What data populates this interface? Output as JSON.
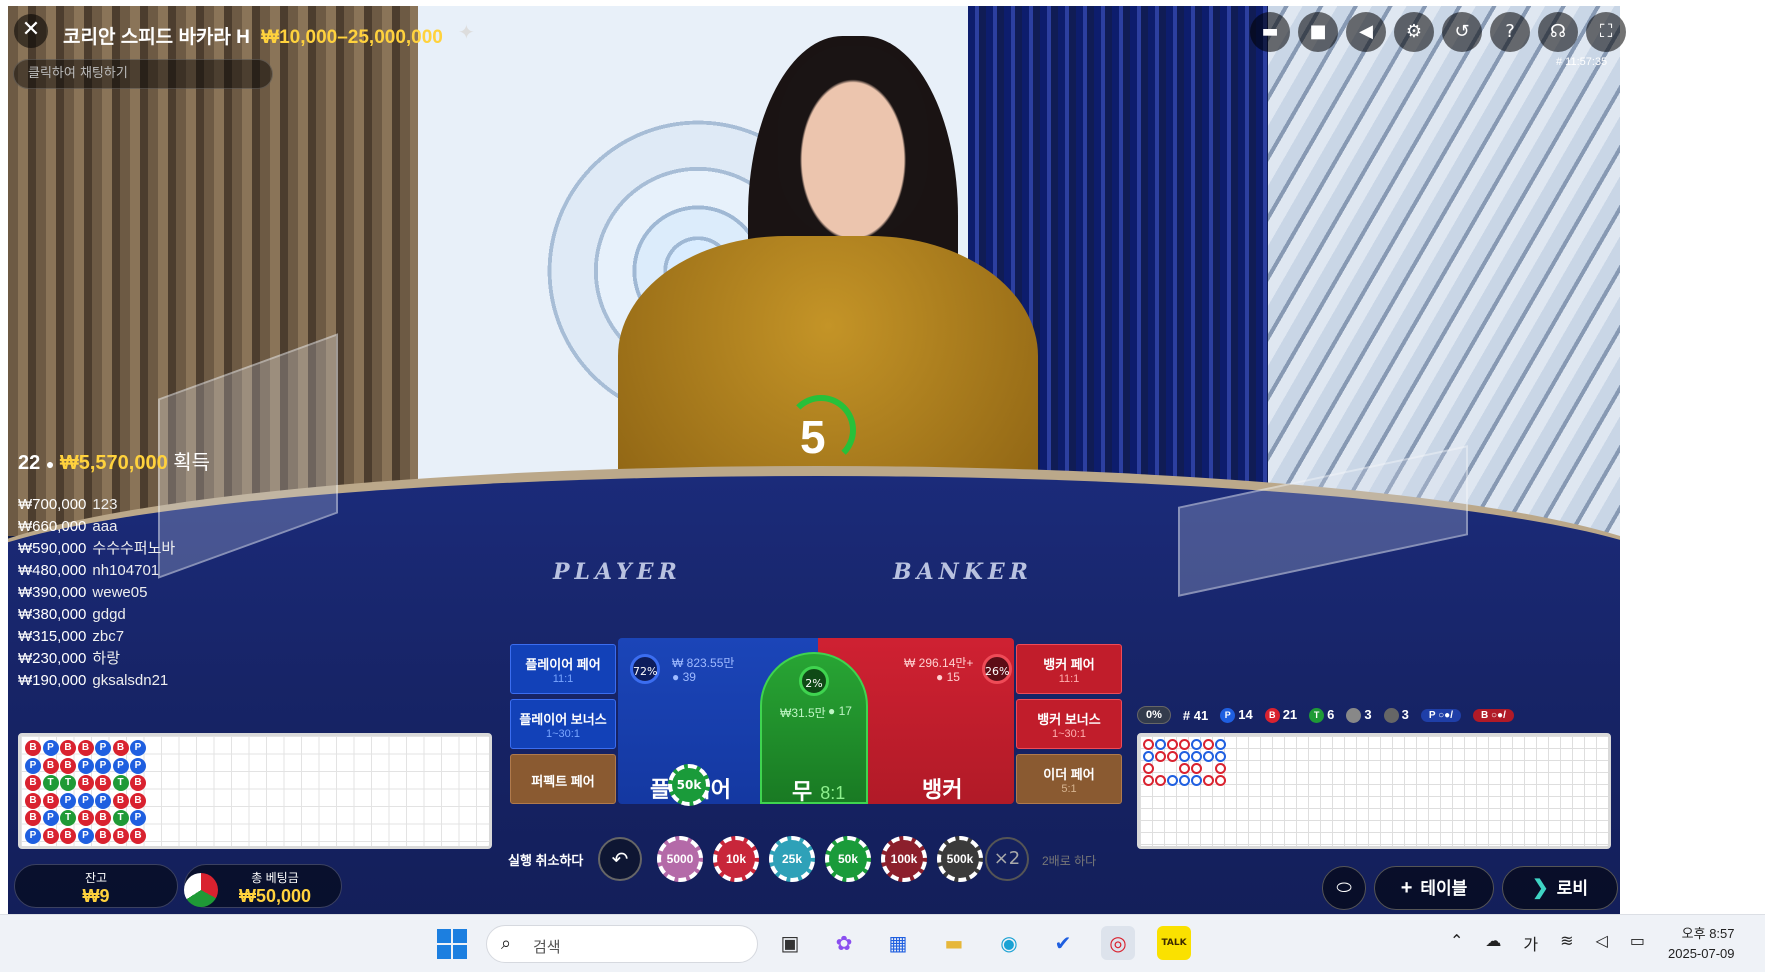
{
  "game": {
    "title": "코리안 스피드 바카라 H",
    "limits": "₩10,000–25,000,000",
    "chat_placeholder": "클릭하여 채팅하기",
    "round_id": "# 11:57:35",
    "timer": "5"
  },
  "top_icons": [
    "chat-icon",
    "video-icon",
    "volume-icon",
    "gear-icon",
    "history-icon",
    "help-icon",
    "headset-icon",
    "fullscreen-icon"
  ],
  "table_words": {
    "player": "PLAYER",
    "banker": "BANKER"
  },
  "winners": {
    "count": "22",
    "total": "₩5,570,000",
    "label": "획득",
    "list": [
      {
        "amount": "₩700,000",
        "name": "123"
      },
      {
        "amount": "₩660,000",
        "name": "aaa"
      },
      {
        "amount": "₩590,000",
        "name": "수수수퍼노바"
      },
      {
        "amount": "₩480,000",
        "name": "nh104701"
      },
      {
        "amount": "₩390,000",
        "name": "wewe05"
      },
      {
        "amount": "₩380,000",
        "name": "gdgd"
      },
      {
        "amount": "₩315,000",
        "name": "zbc7"
      },
      {
        "amount": "₩230,000",
        "name": "하랑"
      },
      {
        "amount": "₩190,000",
        "name": "gksalsdn21"
      }
    ]
  },
  "bets": {
    "player_pair": {
      "label": "플레이어 페어",
      "odds": "11:1"
    },
    "player_bonus": {
      "label": "플레이어 보너스",
      "odds": "1~30:1"
    },
    "perfect_pair": {
      "label": "퍼펙트 페어",
      "odds": ""
    },
    "banker_pair": {
      "label": "뱅커 페어",
      "odds": "11:1"
    },
    "banker_bonus": {
      "label": "뱅커 보너스",
      "odds": "1~30:1"
    },
    "either_pair": {
      "label": "이더 페어",
      "odds": "5:1"
    },
    "player": {
      "label": "플레이어",
      "pct": "72%",
      "pool": "₩ 823.55만",
      "players": "39"
    },
    "tie": {
      "label": "무",
      "odds": "8:1",
      "pct": "2%",
      "pool": "₩31.5만",
      "players": "17"
    },
    "banker": {
      "label": "뱅커",
      "pct": "26%",
      "pool": "₩ 296.14만+",
      "players": "15"
    },
    "placed_chip": "50k"
  },
  "bead_road": [
    [
      "B",
      "P",
      "B",
      "B",
      "B",
      "P"
    ],
    [
      "P",
      "B",
      "T",
      "B",
      "P",
      "B"
    ],
    [
      "B",
      "B",
      "T",
      "P",
      "T",
      "B"
    ],
    [
      "B",
      "P",
      "B",
      "P",
      "B",
      "P"
    ],
    [
      "P",
      "P",
      "B",
      "P",
      "B",
      "B"
    ],
    [
      "B",
      "P",
      "T",
      "B",
      "T",
      "B"
    ],
    [
      "P",
      "P",
      "B",
      "B",
      "P",
      "B"
    ]
  ],
  "stats": {
    "zero": "0%",
    "rounds": "# 41",
    "player": "14",
    "banker": "21",
    "tie": "6",
    "player_pair": "3",
    "banker_pair": "3",
    "predict_p": "P",
    "predict_b": "B"
  },
  "chips": {
    "undo_label": "실행 취소하다",
    "values": [
      "5000",
      "10k",
      "25k",
      "50k",
      "100k",
      "500k"
    ],
    "colors": [
      "#b46aa8",
      "#c8263a",
      "#2ea1b8",
      "#1a9b3a",
      "#8c1f2c",
      "#3a3a3a"
    ],
    "double": "×2",
    "double_label": "2배로 하다"
  },
  "balance": {
    "label": "잔고",
    "value": "₩9"
  },
  "total_bet": {
    "label": "총 베팅금",
    "value": "₩50,000"
  },
  "nav": {
    "tables": "테이블",
    "lobby": "로비"
  },
  "taskbar": {
    "search_placeholder": "검색",
    "time": "오후 8:57",
    "date": "2025-07-09",
    "ime": "가"
  }
}
